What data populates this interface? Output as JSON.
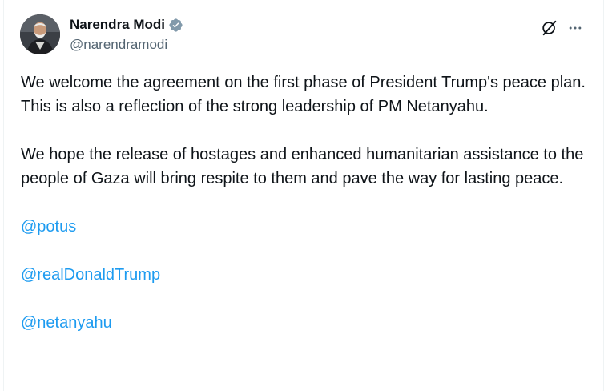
{
  "author": {
    "display_name": "Narendra Modi",
    "handle": "@narendramodi",
    "verified": true
  },
  "icons": {
    "verified": "verified-badge-icon",
    "grok": "grok-icon",
    "more": "more-icon"
  },
  "colors": {
    "mention": "#1d9bf0",
    "text": "#0f1419",
    "secondary": "#536471"
  },
  "post": {
    "paragraphs": [
      "We welcome the agreement on the first phase of President Trump's peace plan. This is also a reflection of the strong leadership of PM Netanyahu.",
      "We hope the release of hostages and enhanced humanitarian assistance to the people of Gaza will bring respite to them and pave the way for lasting peace."
    ],
    "mentions": [
      "@potus",
      "@realDonaldTrump",
      "@netanyahu"
    ]
  }
}
